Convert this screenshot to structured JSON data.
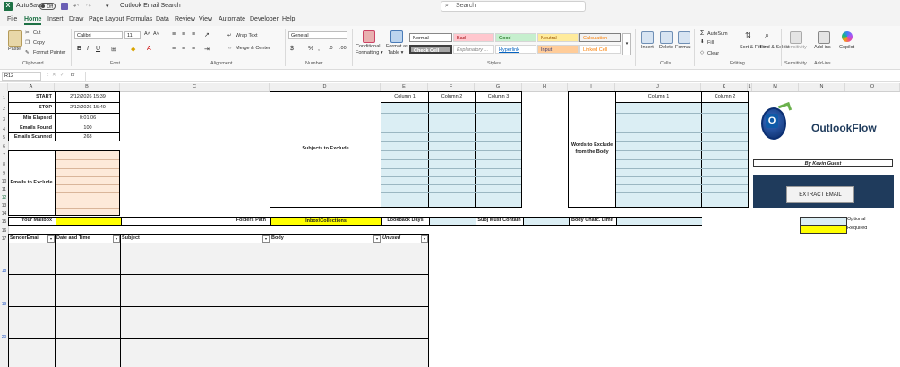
{
  "window": {
    "autosave_label": "AutoSave",
    "autosave_state": "Off",
    "doc_title": "Outlook Email Search",
    "search_placeholder": "Search"
  },
  "menu": [
    "File",
    "Home",
    "Insert",
    "Draw",
    "Page Layout",
    "Formulas",
    "Data",
    "Review",
    "View",
    "Automate",
    "Developer",
    "Help"
  ],
  "menu_active": "Home",
  "ribbon": {
    "clipboard": {
      "paste": "Paste",
      "cut": "Cut",
      "copy": "Copy",
      "format_painter": "Format Painter",
      "label": "Clipboard"
    },
    "font": {
      "name": "Calibri",
      "size": "11",
      "label": "Font"
    },
    "alignment": {
      "wrap": "Wrap Text",
      "merge": "Merge & Center",
      "label": "Alignment"
    },
    "number": {
      "format": "General",
      "label": "Number"
    },
    "styles": {
      "conditional": "Conditional Formatting",
      "format_table": "Format as Table",
      "normal": "Normal",
      "bad": "Bad",
      "good": "Good",
      "neutral": "Neutral",
      "calculation": "Calculation",
      "check_cell": "Check Cell",
      "explanatory": "Explanatory ...",
      "hyperlink": "Hyperlink",
      "input": "Input",
      "linked_cell": "Linked Cell",
      "label": "Styles"
    },
    "cells": {
      "insert": "Insert",
      "delete": "Delete",
      "format": "Format",
      "label": "Cells"
    },
    "editing": {
      "autosum": "AutoSum",
      "fill": "Fill",
      "clear": "Clear",
      "sort": "Sort & Filter",
      "find": "Find & Select",
      "label": "Editing"
    },
    "sensitivity": {
      "btn": "Sensitivity",
      "label": "Sensitivity"
    },
    "addins": {
      "btn": "Add-ins",
      "label": "Add-ins"
    },
    "copilot": "Copilot"
  },
  "formula_bar": {
    "name_box": "R12",
    "fx": "fx",
    "value": ""
  },
  "columns": [
    "A",
    "B",
    "C",
    "D",
    "E",
    "F",
    "G",
    "H",
    "I",
    "J",
    "K",
    "L",
    "M",
    "N",
    "O"
  ],
  "rows": [
    "1",
    "2",
    "3",
    "4",
    "5",
    "6",
    "7",
    "8",
    "9",
    "10",
    "11",
    "12",
    "13",
    "14",
    "15",
    "16",
    "17",
    "18",
    "19",
    "20"
  ],
  "stats": {
    "start_label": "START",
    "start_value": "2/12/2026 15:39",
    "stop_label": "STOP",
    "stop_value": "2/12/2026 15:40",
    "elapsed_label": "Min Elapsed",
    "elapsed_value": "0:01:06",
    "found_label": "Emails Found",
    "found_value": "100",
    "scanned_label": "Emails Scanned",
    "scanned_value": "268"
  },
  "emails_exclude_label": "Emails to Exclude",
  "subjects_exclude_label": "Subjects to Exclude",
  "words_exclude_label": "Words to Exclude from the Body",
  "column1": "Column 1",
  "column2": "Column 2",
  "column3": "Column 3",
  "row15": {
    "mailbox_label": "Your Mailbox",
    "folders_label": "Folders Path",
    "folders_value": "Inbox\\Collections",
    "lookback_label": "Lookback Days",
    "subj_label": "Subj Must Contain",
    "body_label": "Body Charc. Limit"
  },
  "results_headers": [
    "SenderEmail",
    "Date and Time",
    "Subject",
    "Body",
    "Unused"
  ],
  "logo_text": "OutlookFlow",
  "author": "By Kevin Guest",
  "extract_button": "EXTRACT EMAIL",
  "legend": {
    "optional": "Optional",
    "required": "Required"
  },
  "colors": {
    "excel_green": "#1e7145",
    "blue_fill": "#dbeef4",
    "peach_fill": "#fde9d9",
    "required_yellow": "#ffff00",
    "panel_navy": "#1f3b5c"
  }
}
